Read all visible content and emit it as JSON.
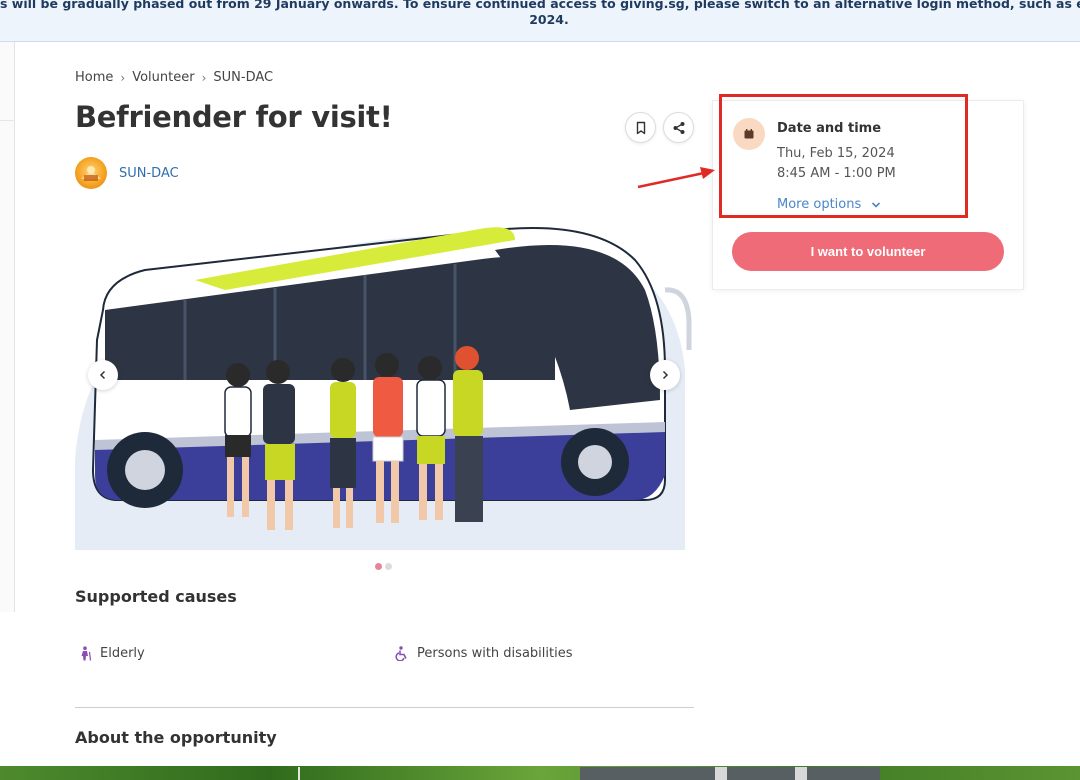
{
  "banner": {
    "line1": "s will be gradually phased out from 29 January onwards. To ensure continued access to giving.sg, please switch to an alternative login method, such as email or Singpass",
    "line2": "2024."
  },
  "breadcrumb": {
    "items": [
      "Home",
      "Volunteer",
      "SUN-DAC"
    ]
  },
  "page": {
    "title": "Befriender for visit!",
    "organization": "SUN-DAC"
  },
  "carousel": {
    "slide_count": 2,
    "active_index": 0
  },
  "causes": {
    "heading": "Supported causes",
    "items": [
      {
        "label": "Elderly",
        "icon": "elderly-icon"
      },
      {
        "label": "Persons with disabilities",
        "icon": "wheelchair-icon"
      }
    ]
  },
  "about": {
    "heading": "About the opportunity"
  },
  "schedule": {
    "label": "Date and time",
    "date": "Thu, Feb 15, 2024",
    "time": "8:45 AM - 1:00 PM",
    "more_options": "More options",
    "cta": "I want to volunteer"
  },
  "colors": {
    "accent": "#ef6b78",
    "link": "#2f6fb0",
    "annotation": "#e02a24",
    "cause_icon": "#8a4fb5"
  }
}
